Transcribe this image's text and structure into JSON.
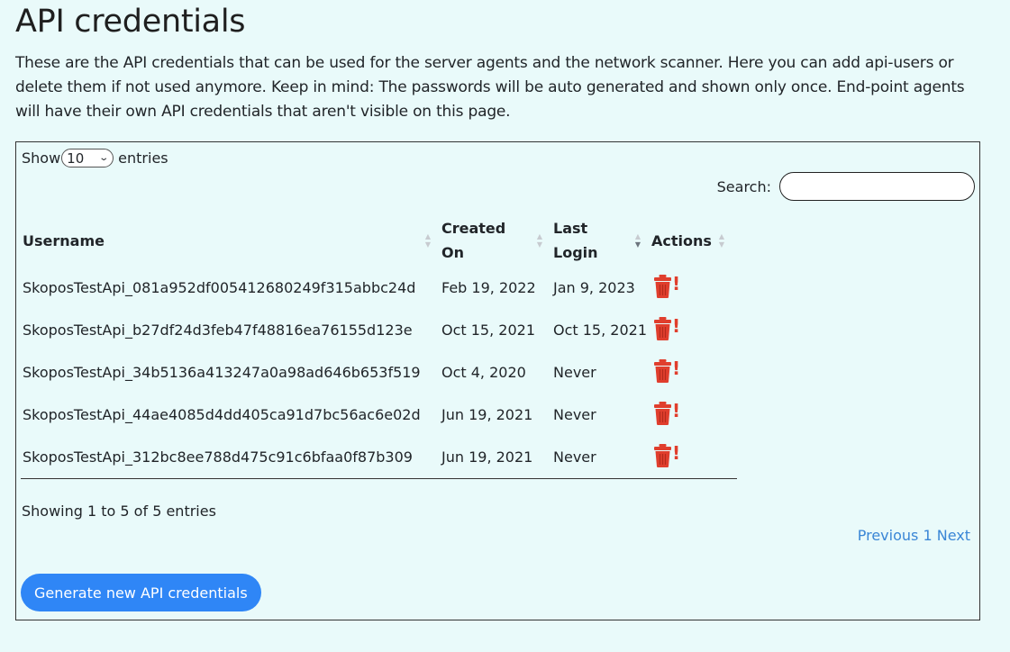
{
  "page": {
    "title": "API credentials",
    "intro": "These are the API credentials that can be used for the server agents and the network scanner. Here you can add api-users or delete them if not used anymore. Keep in mind: The passwords will be auto generated and shown only once. End-point agents will have their own API credentials that aren't visible on this page."
  },
  "table_controls": {
    "show_label": "Show",
    "entries_value": "10",
    "entries_label": "entries",
    "search_label": "Search:",
    "search_value": ""
  },
  "columns": [
    {
      "label": "Username",
      "sort": "none"
    },
    {
      "label": "Created On",
      "sort": "none"
    },
    {
      "label": "Last Login",
      "sort": "descending"
    },
    {
      "label": "Actions",
      "sort": "none"
    }
  ],
  "rows": [
    {
      "username": "SkoposTestApi_081a952df005412680249f315abbc24d",
      "created": "Feb 19, 2022",
      "last_login": "Jan 9, 2023"
    },
    {
      "username": "SkoposTestApi_b27df24d3feb47f48816ea76155d123e",
      "created": "Oct 15, 2021",
      "last_login": "Oct 15, 2021"
    },
    {
      "username": "SkoposTestApi_34b5136a413247a0a98ad646b653f519",
      "created": "Oct 4, 2020",
      "last_login": "Never"
    },
    {
      "username": "SkoposTestApi_44ae4085d4dd405ca91d7bc56ac6e02d",
      "created": "Jun 19, 2021",
      "last_login": "Never"
    },
    {
      "username": "SkoposTestApi_312bc8ee788d475c91c6bfaa0f87b309",
      "created": "Jun 19, 2021",
      "last_login": "Never"
    }
  ],
  "row_action": {
    "icon": "trash-icon",
    "marker": "!"
  },
  "footer": {
    "info": "Showing 1 to 5 of 5 entries",
    "previous": "Previous",
    "page": "1",
    "next": "Next"
  },
  "actions": {
    "generate_label": "Generate new API credentials"
  },
  "colors": {
    "background": "#e9fafa",
    "accent": "#2f86f6",
    "link": "#3a86d6",
    "danger": "#e03e2d"
  }
}
